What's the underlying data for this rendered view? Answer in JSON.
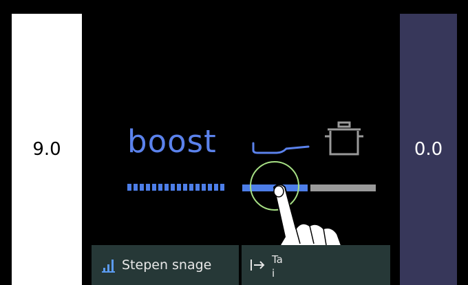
{
  "left_zone": {
    "value": "9.0"
  },
  "right_zone": {
    "value": "0.0"
  },
  "mode": {
    "label": "boost"
  },
  "power_slider": {
    "level_fraction": 0.5,
    "segments_dotted": 16
  },
  "buttons": {
    "stages": {
      "label": "Stepen snage",
      "icon": "bar-chart-icon"
    },
    "timer": {
      "label_line1": "Ta",
      "label_line2": "i",
      "icon": "arrow-to-bar-icon"
    }
  },
  "colors": {
    "accent": "#5b82ec",
    "right_zone_bg": "#37375a",
    "button_bg": "#263837",
    "touch_ring": "#a6df84"
  },
  "icons": [
    "pan-icon",
    "pot-icon",
    "hand-icon"
  ]
}
